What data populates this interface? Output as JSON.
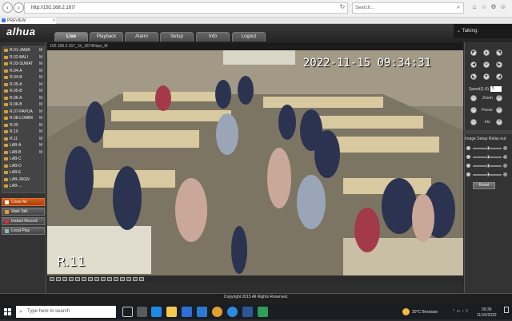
{
  "browser": {
    "url": "http://192.168.2.167/",
    "search_placeholder": "Search...",
    "tab_title": "PREVIEW",
    "icons": [
      "back-icon",
      "forward-icon",
      "refresh-icon",
      "search-icon",
      "home-icon",
      "star-icon",
      "settings-icon",
      "smiley-icon"
    ]
  },
  "app": {
    "logo": "alhua",
    "nav": [
      "Live",
      "Playback",
      "Alarm",
      "Setup",
      "Info",
      "Logout"
    ],
    "active_nav": "Live",
    "talking_label": "Talking:"
  },
  "cameras": [
    {
      "name": "R.01-JAWA",
      "flag": "M"
    },
    {
      "name": "R.02-BALI",
      "flag": "M"
    },
    {
      "name": "R.03-SUMAT",
      "flag": "M"
    },
    {
      "name": "R.04-A",
      "flag": "M"
    },
    {
      "name": "R.04-B",
      "flag": "M"
    },
    {
      "name": "R.05-A",
      "flag": "M"
    },
    {
      "name": "R.05-B",
      "flag": "M"
    },
    {
      "name": "R.06-A",
      "flag": "M"
    },
    {
      "name": "R.06-B",
      "flag": "M"
    },
    {
      "name": "R.07-PAPUA",
      "flag": "M"
    },
    {
      "name": "R.08-LOMBK",
      "flag": "M"
    },
    {
      "name": "R.09",
      "flag": "M"
    },
    {
      "name": "R.10",
      "flag": "M"
    },
    {
      "name": "R.11",
      "flag": "M"
    },
    {
      "name": "LAB-A",
      "flag": "M"
    },
    {
      "name": "LAB-B",
      "flag": "M"
    },
    {
      "name": "LAB-C",
      "flag": ""
    },
    {
      "name": "LAB-D",
      "flag": ""
    },
    {
      "name": "LAB-E",
      "flag": ""
    },
    {
      "name": "LAB-JRGN",
      "flag": ""
    },
    {
      "name": "LAB-...",
      "flag": ""
    }
  ],
  "left_buttons": [
    "Close All",
    "Start Talk",
    "Instant Record",
    "Local Play"
  ],
  "video": {
    "header": "192.168.2.167_1h_1874Kbps_M",
    "timestamp": "2022-11-15  09:34:31",
    "room_label": "R.11"
  },
  "ptz": {
    "speed_label": "Speed(1-8)",
    "speed_value": "5",
    "zoom_label": "Zoom",
    "focus_label": "Focus",
    "iris_label": "Iris",
    "image_setup_label": "Image Setup",
    "relay_out_label": "Relay-out",
    "reset_label": "Reset",
    "sliders": [
      {
        "name": "brightness",
        "value": 0.5
      },
      {
        "name": "contrast",
        "value": 0.5
      },
      {
        "name": "saturation",
        "value": 0.5
      },
      {
        "name": "hue",
        "value": 0.5
      }
    ]
  },
  "footer": "Copyright 2015 All Rights Reserved.",
  "taskbar": {
    "search_placeholder": "Type here to search",
    "weather": "30°C  Berawan",
    "time": "09:36",
    "date": "11/15/2022",
    "apps": [
      "task-view-icon",
      "edge-icon",
      "explorer-icon",
      "store-icon",
      "mail-icon",
      "chrome-icon",
      "ie-icon",
      "word-icon",
      "app-icon"
    ]
  }
}
